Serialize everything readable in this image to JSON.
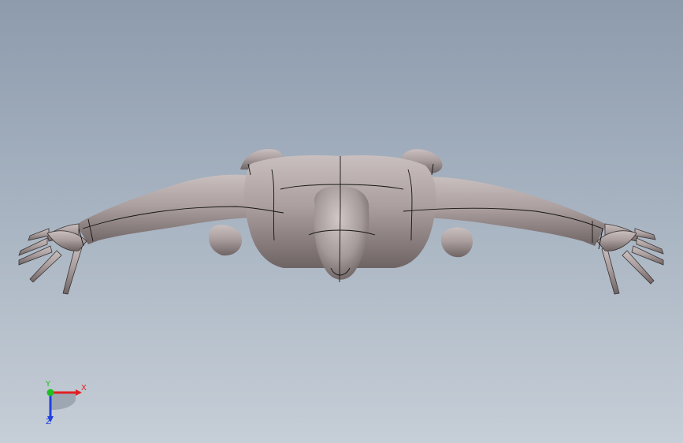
{
  "viewport": {
    "background_top": "#8d9bad",
    "background_bottom": "#c6ced7"
  },
  "model": {
    "name_icon": "human-figure-3d-model",
    "surface_color": "#a89c9c",
    "edge_color": "#1a1a1a"
  },
  "triad": {
    "x_label": "X",
    "y_label": "Y",
    "z_label": "Z",
    "x_color": "#e02020",
    "y_color": "#20c020",
    "z_color": "#2040e0"
  }
}
